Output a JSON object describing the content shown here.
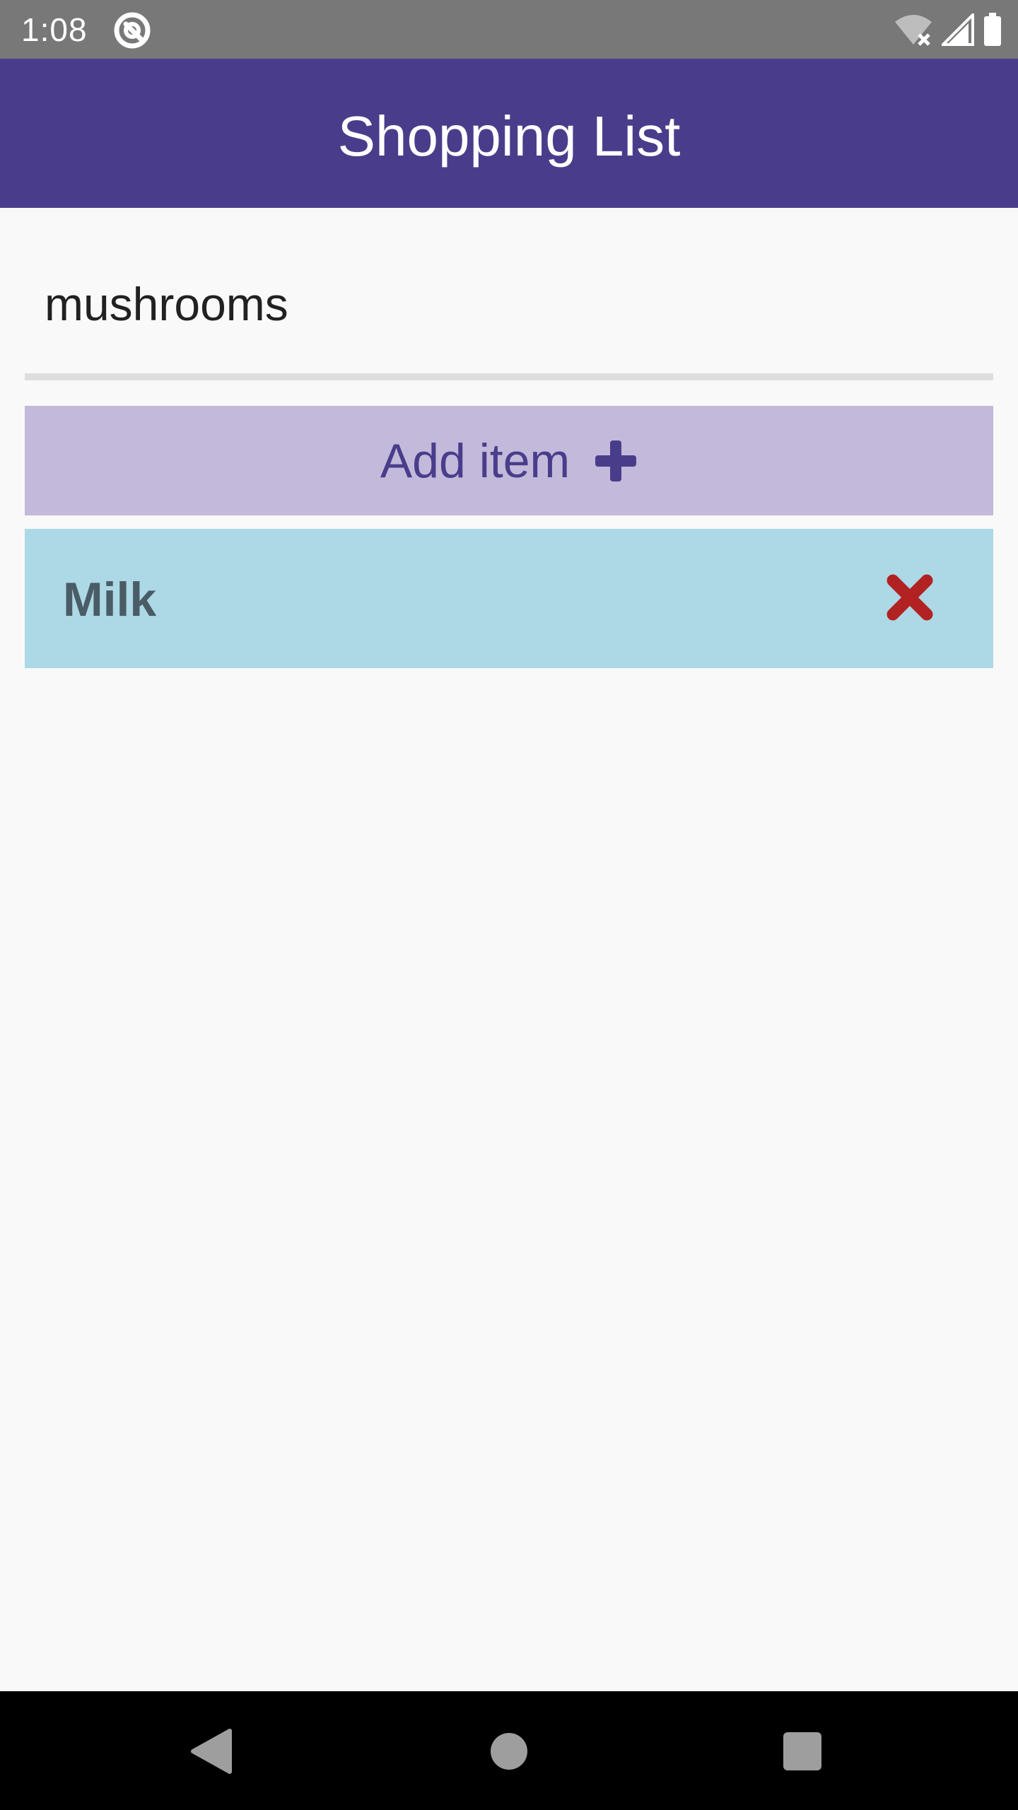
{
  "status_bar": {
    "time": "1:08",
    "icons": [
      "app-notification-icon",
      "wifi-off-icon",
      "cell-signal-icon",
      "battery-icon"
    ]
  },
  "app_bar": {
    "title": "Shopping List",
    "color": "#493d8b"
  },
  "item_input": {
    "value": "mushrooms"
  },
  "add_button": {
    "label": "Add item",
    "icon": "plus-icon",
    "color": "#c3b9da"
  },
  "list": {
    "items": [
      {
        "label": "Milk",
        "delete_icon": "close-icon",
        "background": "#add8e6"
      }
    ]
  },
  "nav_bar": {
    "buttons": [
      "back-icon",
      "home-icon",
      "recents-icon"
    ]
  }
}
